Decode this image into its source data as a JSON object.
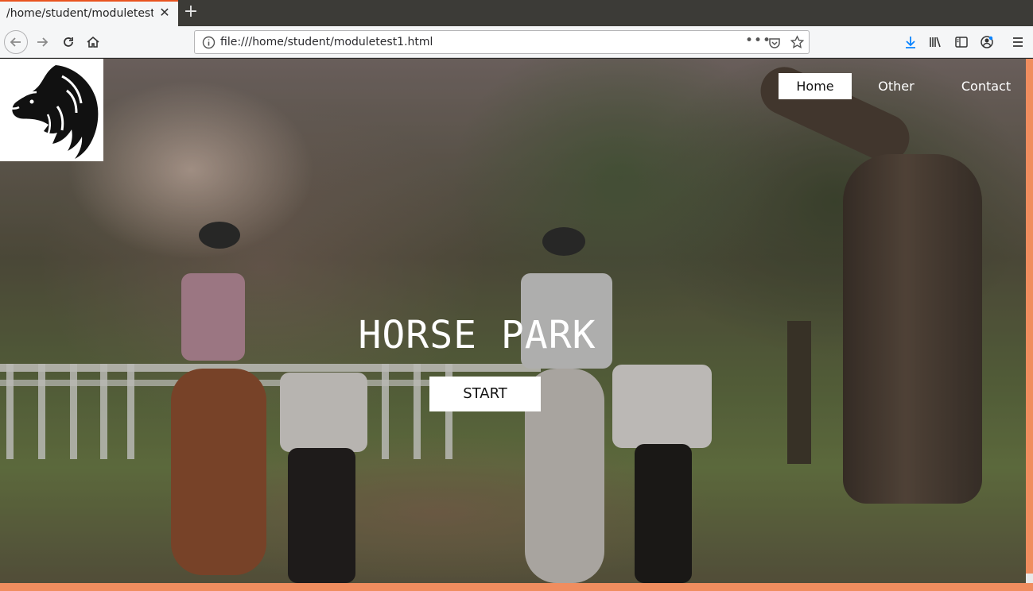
{
  "browser": {
    "tab_title": "/home/student/moduletest1.html",
    "tab_close": "✕",
    "new_tab": "+",
    "url": "file:///home/student/moduletest1.html",
    "url_more": "•••"
  },
  "site": {
    "nav": {
      "home": "Home",
      "other": "Other",
      "contact": "Contact"
    },
    "hero": {
      "title": "HORSE PARK",
      "button": "START"
    }
  },
  "colors": {
    "accent": "#f08d5f",
    "tab_accent": "#e95420"
  }
}
